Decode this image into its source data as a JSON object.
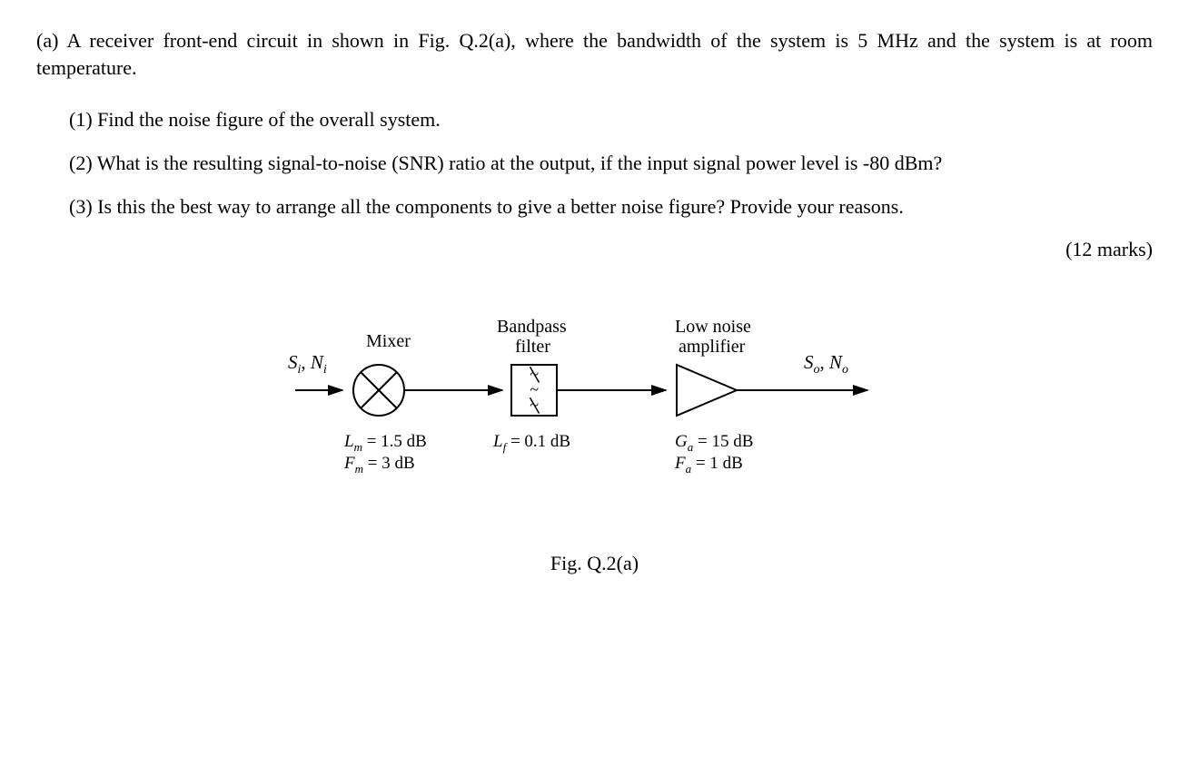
{
  "intro": "(a) A receiver front-end circuit in shown in Fig. Q.2(a), where the bandwidth of the system is 5 MHz and the system is at room temperature.",
  "sub": {
    "q1": "(1) Find the noise figure of the overall system.",
    "q2": "(2) What is the resulting signal-to-noise (SNR) ratio at the output, if the input signal power level is -80 dBm?",
    "q3": "(3) Is this the best way to arrange all the components to give a better noise figure? Provide your reasons."
  },
  "marks": "(12 marks)",
  "figure": {
    "caption": "Fig. Q.2(a)",
    "labels": {
      "mixer": "Mixer",
      "bpf1": "Bandpass",
      "bpf2": "filter",
      "lna1": "Low noise",
      "lna2": "amplifier",
      "in_S": "S",
      "in_i": "i",
      "sep": ", ",
      "in_N": "N",
      "out_S": "S",
      "out_o": "o",
      "out_N": "N"
    },
    "params": {
      "mixer_L": "= 1.5 dB",
      "mixer_L_sym": "L",
      "mixer_L_sub": "m",
      "mixer_F": "= 3  dB",
      "mixer_F_sym": "F",
      "mixer_F_sub": "m",
      "bpf_L": "= 0.1 dB",
      "bpf_L_sym": "L",
      "bpf_L_sub": "f",
      "lna_G": "= 15 dB",
      "lna_G_sym": "G",
      "lna_G_sub": "a",
      "lna_F": "= 1 dB",
      "lna_F_sym": "F",
      "lna_F_sub": "a"
    },
    "tildes": {
      "t1": "~",
      "t2": "~",
      "t3": "~"
    }
  }
}
